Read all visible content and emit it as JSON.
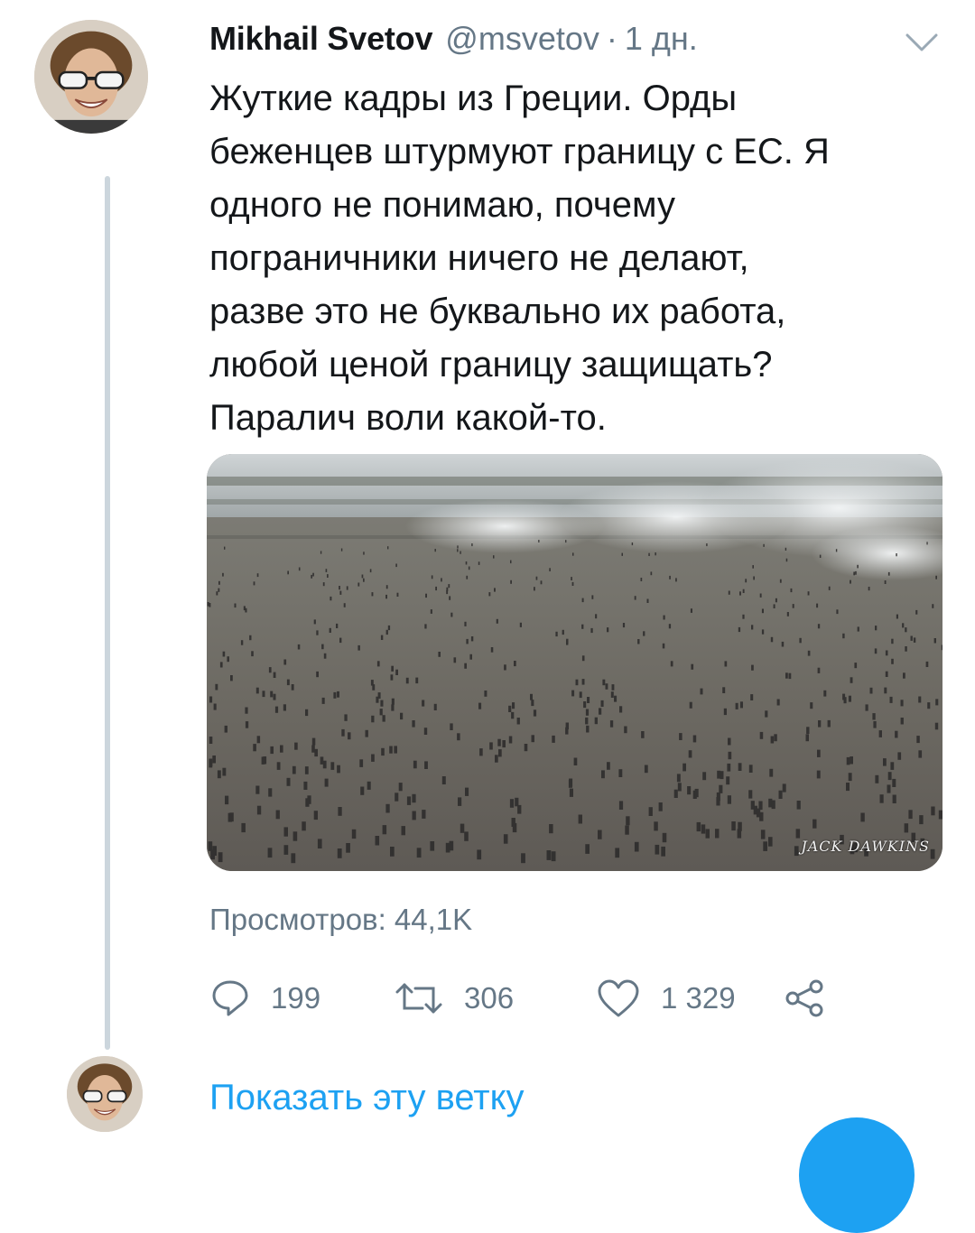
{
  "tweet": {
    "author_name": "Mikhail Svetov",
    "author_handle": "@msvetov",
    "separator": "·",
    "time": "1 дн.",
    "text": "Жуткие кадры из Греции. Орды\nбеженцев штурмуют границу с ЕС. Я\nодного не понимаю, почему\nпограничники ничего не делают,\nразве это не буквально их работа,\nлюбой ценой границу защищать?\nПаралич воли какой-то.",
    "media_watermark": "JACK DAWKINS",
    "views": "Просмотров: 44,1K",
    "replies": "199",
    "retweets": "306",
    "likes": "1 329"
  },
  "thread": {
    "show_thread_label": "Показать эту ветку"
  },
  "icons": {
    "menu": "chevron-down-icon",
    "reply": "reply-icon",
    "retweet": "retweet-icon",
    "like": "heart-icon",
    "share": "share-icon"
  },
  "colors": {
    "text": "#14171a",
    "secondary": "#657786",
    "accent": "#1da1f2",
    "thread_line": "#ccd6dd"
  }
}
